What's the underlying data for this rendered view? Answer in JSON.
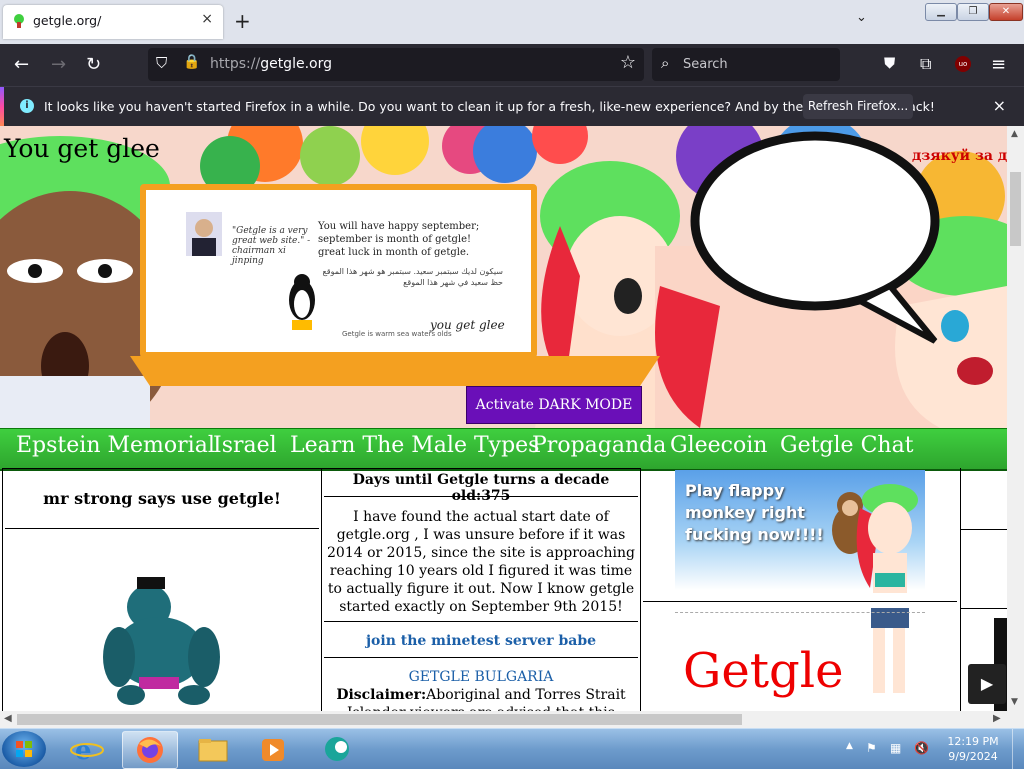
{
  "browser": {
    "tab_title": "getgle.org/",
    "tab_close": "×",
    "new_tab": "+",
    "tab_list": "⌄",
    "url_scheme": "https://",
    "url_host": "getgle.org",
    "search_placeholder": "Search",
    "notification": {
      "message": "It looks like you haven't started Firefox in a while. Do you want to clean it up for a fresh, like-new experience? And by the way, welcome back!",
      "button": "Refresh Firefox...",
      "close": "×"
    }
  },
  "site": {
    "title": "You get glee",
    "thanks_text": "дзякуй за д",
    "board": {
      "quote": "\"Getgle is a very great web site.\" - chairman xi jinping",
      "message": "You will have happy september; september is month of getgle! great luck in month of getgle.",
      "message_foreign": "سيكون لديك سبتمبر سعيد. سبتمبر هو شهر هذا الموقع حظ سعيد في شهر هذا الموقع",
      "signature": "you get glee",
      "footnote": "Getgle is warm sea waters olds"
    },
    "dark_mode_button": "Activate DARK MODE",
    "menu": [
      "Epstein Memorial",
      "Israel",
      "Learn The Male Types",
      "Propaganda",
      "Gleecoin",
      "Getgle Chat"
    ],
    "col1_heading": "mr strong says use getgle!",
    "countdown": "Days until Getgle turns a decade old:375",
    "update_text": "I have found the actual start date of getgle.org , I was unsure before if it was 2014 or 2015, since the site is approaching reaching 10 years old I figured it was time to actually figure it out. Now I know getgle started exactly on September 9th 2015!",
    "join_link": "join the minetest server babe",
    "bulgaria_link": "GETGLE BULGARIA",
    "disclaimer_label": "Disclaimer:",
    "disclaimer_text": "Aboriginal and Torres Strait Islander viewers are advised that this website may contain images, voices and",
    "flappy_ad": "Play flappy monkey right fucking now!!!!",
    "logo_text": "Getgle"
  },
  "taskbar": {
    "time": "12:19 PM",
    "date": "9/9/2024"
  },
  "colors": {
    "menu_green": "#2ea52e",
    "dark_button": "#6a0fb8",
    "link_blue": "#1b5fa8",
    "firefox_chrome": "#2b2a33"
  }
}
